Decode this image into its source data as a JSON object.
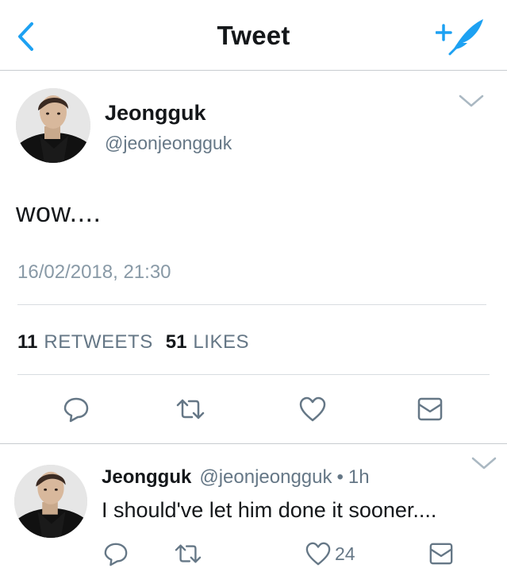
{
  "header": {
    "title": "Tweet",
    "back_icon": "chevron-left-icon",
    "compose_icon": "compose-tweet-icon"
  },
  "colors": {
    "accent": "#1da1f2",
    "secondary_text": "#657786",
    "timestamp": "#8899a6",
    "divider": "#d8dde1",
    "icon_gray": "#657786"
  },
  "main_tweet": {
    "author": {
      "name": "Jeongguk",
      "handle": "@jeonjeongguk"
    },
    "text": "wow....",
    "timestamp": "16/02/2018, 21:30",
    "stats": {
      "retweets_count": "11",
      "retweets_label": "RETWEETS",
      "likes_count": "51",
      "likes_label": "LIKES"
    },
    "actions": [
      "reply-icon",
      "retweet-icon",
      "like-icon",
      "direct-message-icon"
    ]
  },
  "reply": {
    "author": {
      "name": "Jeongguk",
      "handle": "@jeonjeongguk"
    },
    "separator": "•",
    "time": "1h",
    "text": "I should've let him done it sooner....",
    "like_count": "24",
    "actions": [
      "reply-icon",
      "retweet-icon",
      "like-icon",
      "direct-message-icon"
    ]
  }
}
